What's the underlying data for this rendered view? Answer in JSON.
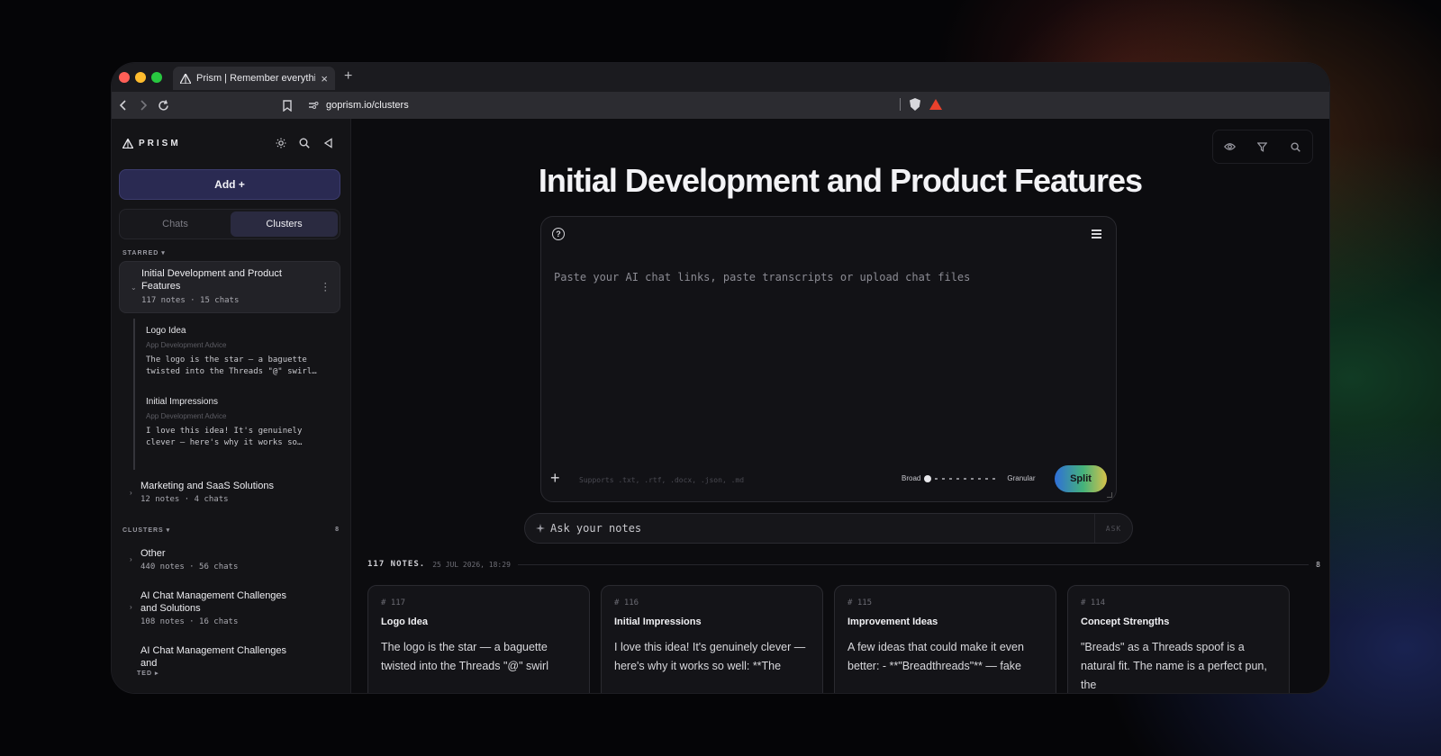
{
  "browser": {
    "tab_title": "Prism | Remember everything",
    "tab_close": "×",
    "new_tab": "+",
    "url": "goprism.io/clusters"
  },
  "sidebar": {
    "brand": "PRISM",
    "add_label": "Add +",
    "tabs": [
      {
        "label": "Chats",
        "active": false
      },
      {
        "label": "Clusters",
        "active": true
      }
    ],
    "starred_label": "STARRED ▾",
    "starred": [
      {
        "title": "Initial Development and Product Features",
        "meta": "117 notes · 15 chats",
        "notes": [
          {
            "title": "Logo Idea",
            "sub": "App Development Advice",
            "body": "The logo is the star — a baguette\ntwisted into the Threads \"@\" swirl…"
          },
          {
            "title": "Initial Impressions",
            "sub": "App Development Advice",
            "body": "I love this idea! It's genuinely\nclever — here's why it works so…"
          }
        ]
      },
      {
        "title": "Marketing and SaaS Solutions",
        "meta": "12 notes · 4 chats"
      }
    ],
    "clusters_label": "CLUSTERS ▾",
    "clusters_count": "8",
    "clusters": [
      {
        "title": "Other",
        "meta": "440 notes · 56 chats"
      },
      {
        "title": "AI Chat Management Challenges and Solutions",
        "meta": "108 notes · 16 chats"
      },
      {
        "title": "AI Chat Management Challenges and",
        "meta": ""
      }
    ],
    "bottom_label": "TED ▸"
  },
  "main": {
    "title": "Initial Development and Product Features",
    "composer": {
      "placeholder": "Paste your AI chat links, paste transcripts or upload chat files",
      "supports": "Supports .txt, .rtf, .docx, .json, .md",
      "slider_left": "Broad",
      "slider_right": "Granular",
      "split_label": "Split"
    },
    "ask": {
      "placeholder": "Ask your notes",
      "button": "ASK"
    },
    "notes_header": {
      "count": "117 NOTES.",
      "date": "25 JUL 2026, 18:29",
      "end": "8"
    },
    "cards": [
      {
        "num": "# 117",
        "title": "Logo Idea",
        "body": "The logo is the star — a baguette twisted into the Threads \"@\" swirl"
      },
      {
        "num": "# 116",
        "title": "Initial Impressions",
        "body": "I love this idea! It's genuinely clever — here's why it works so well: **The"
      },
      {
        "num": "# 115",
        "title": "Improvement Ideas",
        "body": "A few ideas that could make it even better: - **\"Breadthreads\"** — fake"
      },
      {
        "num": "# 114",
        "title": "Concept Strengths",
        "body": "\"Breads\" as a Threads spoof is a natural fit. The name is a perfect pun, the"
      }
    ]
  },
  "colors": {
    "accent": "#2a2a52",
    "split_gradient": [
      "#2f6fd8",
      "#45b37a",
      "#d7c24a"
    ],
    "traffic": [
      "#ff5f57",
      "#febc2e",
      "#28c840"
    ],
    "brave": "#e8412c"
  }
}
